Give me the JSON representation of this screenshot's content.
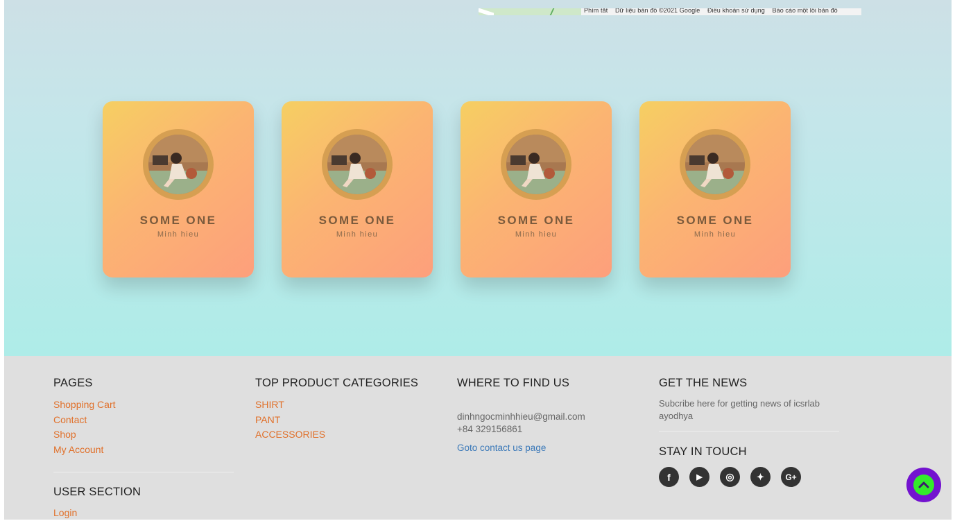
{
  "map_attribution": [
    "Phím tắt",
    "Dữ liệu bản đồ ©2021 Google",
    "Điều khoản sử dụng",
    "Báo cáo một lỗi bản đồ"
  ],
  "team": [
    {
      "name": "SOME ONE",
      "subtitle": "Minh hieu"
    },
    {
      "name": "SOME ONE",
      "subtitle": "Minh hieu"
    },
    {
      "name": "SOME ONE",
      "subtitle": "Minh hieu"
    },
    {
      "name": "SOME ONE",
      "subtitle": "Minh hieu"
    }
  ],
  "footer": {
    "pages": {
      "title": "PAGES",
      "links": [
        "Shopping Cart",
        "Contact",
        "Shop",
        "My Account"
      ]
    },
    "user_section": {
      "title": "USER SECTION",
      "links": [
        "Login"
      ]
    },
    "categories": {
      "title": "TOP PRODUCT CATEGORIES",
      "links": [
        "SHIRT",
        "PANT",
        "ACCESSORIES"
      ]
    },
    "find_us": {
      "title": "WHERE TO FIND US",
      "email": "dinhngocminhhieu@gmail.com",
      "phone": "+84 329156861",
      "contact_link": "Goto contact us page"
    },
    "news": {
      "title": "GET THE NEWS",
      "text": "Subcribe here for getting news of icsrlab ayodhya"
    },
    "stay_in_touch": {
      "title": "STAY IN TOUCH",
      "icons": [
        "facebook-icon",
        "youtube-icon",
        "instagram-icon",
        "twitter-icon",
        "google-plus-icon"
      ],
      "glyphs": [
        "f",
        "▶",
        "◎",
        "✦",
        "G+"
      ]
    }
  },
  "colors": {
    "link": "#e0702a",
    "contact_link": "#3a78b8",
    "scroll_top_outer": "#7313cf",
    "scroll_top_inner": "#33ec2a"
  }
}
